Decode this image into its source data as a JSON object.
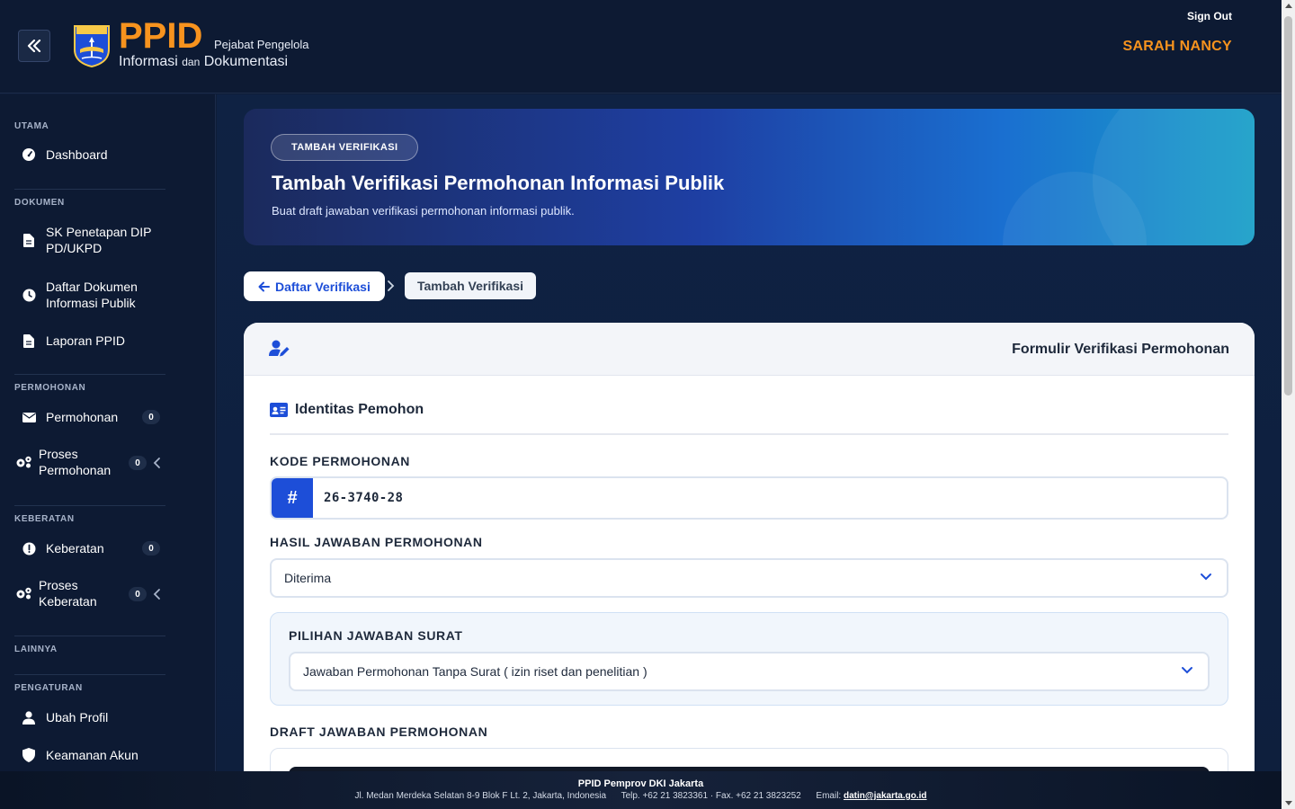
{
  "header": {
    "brand_main": "PPID",
    "brand_sub1": "Pejabat Pengelola",
    "brand_line2_a": "Informasi",
    "brand_line2_b": "dan",
    "brand_line2_c": "Dokumentasi",
    "sign_out": "Sign Out",
    "user_name": "SARAH NANCY"
  },
  "sidebar": {
    "sections": {
      "utama": "UTAMA",
      "dokumen": "DOKUMEN",
      "permohonan": "PERMOHONAN",
      "keberatan": "KEBERATAN",
      "lainnya": "LAINNYA",
      "pengaturan": "PENGATURAN"
    },
    "items": {
      "dashboard": "Dashboard",
      "sk_penetapan_1": "SK Penetapan DIP",
      "sk_penetapan_2": "PD/UKPD",
      "daftar_dokumen_1": "Daftar Dokumen",
      "daftar_dokumen_2": "Informasi Publik",
      "laporan": "Laporan PPID",
      "permohonan": "Permohonan",
      "permohonan_count": "0",
      "proses_permohonan_1": "Proses",
      "proses_permohonan_2": "Permohonan",
      "proses_permohonan_count": "0",
      "keberatan": "Keberatan",
      "keberatan_count": "0",
      "proses_keberatan_1": "Proses",
      "proses_keberatan_2": "Keberatan",
      "proses_keberatan_count": "0",
      "ubah_profil": "Ubah Profil",
      "keamanan_akun": "Keamanan Akun"
    }
  },
  "hero": {
    "pill": "TAMBAH VERIFIKASI",
    "title": "Tambah Verifikasi Permohonan Informasi Publik",
    "subtitle": "Buat draft jawaban verifikasi permohonan informasi publik."
  },
  "breadcrumb": {
    "back": "Daftar Verifikasi",
    "current": "Tambah Verifikasi"
  },
  "form": {
    "card_title": "Formulir Verifikasi Permohonan",
    "section_title": "Identitas Pemohon",
    "kode_label": "KODE PERMOHONAN",
    "kode_prefix": "#",
    "kode_value": "26-3740-28",
    "hasil_label": "HASIL JAWABAN PERMOHONAN",
    "hasil_value": "Diterima",
    "pilihan_label": "PILIHAN JAWABAN SURAT",
    "pilihan_value": "Jawaban Permohonan Tanpa Surat ( izin riset dan penelitian )",
    "draft_label": "DRAFT JAWABAN PERMOHONAN"
  },
  "footer": {
    "org": "PPID Pemprov DKI Jakarta",
    "address": "Jl. Medan Merdeka Selatan 8-9 Blok F Lt. 2, Jakarta, Indonesia",
    "phone": "Telp. +62 21 3823361 · Fax. +62 21 3823252",
    "email_label": "Email:",
    "email": "datin@jakarta.go.id"
  },
  "colors": {
    "accent_orange": "#f7931e",
    "primary_blue": "#1d4ed8",
    "navy_bg": "#0d1a33"
  }
}
